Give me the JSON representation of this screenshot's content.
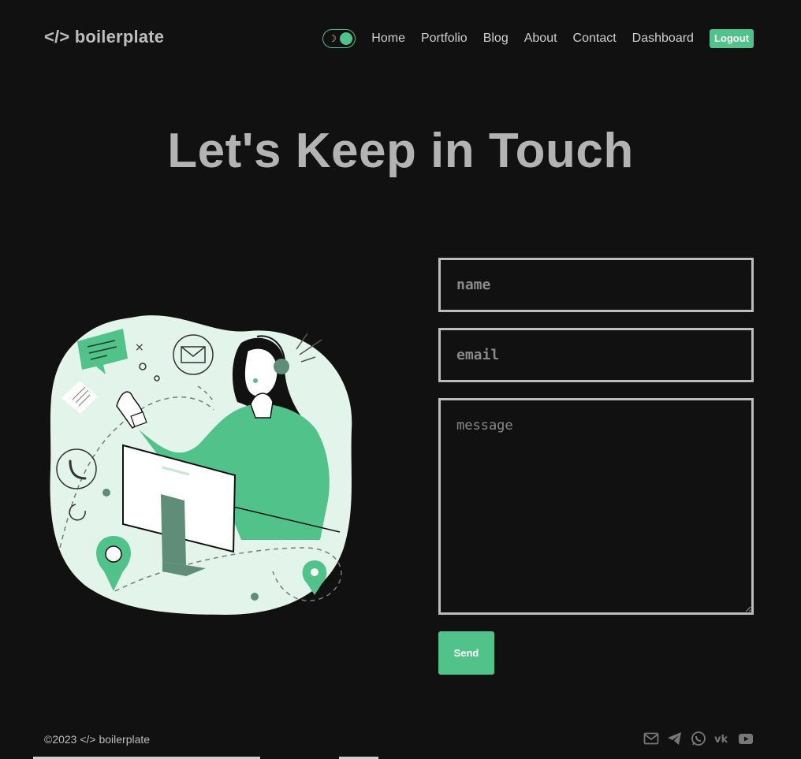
{
  "header": {
    "logo": "</> boilerplate",
    "theme_toggle_icon": "moon-icon",
    "nav": [
      "Home",
      "Portfolio",
      "Blog",
      "About",
      "Contact",
      "Dashboard"
    ],
    "logout": "Logout"
  },
  "main": {
    "title": "Let's Keep in Touch",
    "illustration": "customer-support-illustration"
  },
  "form": {
    "name_placeholder": "name",
    "email_placeholder": "email",
    "message_placeholder": "message",
    "send": "Send"
  },
  "footer": {
    "copyright": "©2023 </> boilerplate",
    "socials": [
      "mail-icon",
      "telegram-icon",
      "whatsapp-icon",
      "vk-icon",
      "youtube-icon"
    ]
  },
  "colors": {
    "background": "#111111",
    "accent": "#52c28b",
    "text": "#cfcfcf"
  }
}
